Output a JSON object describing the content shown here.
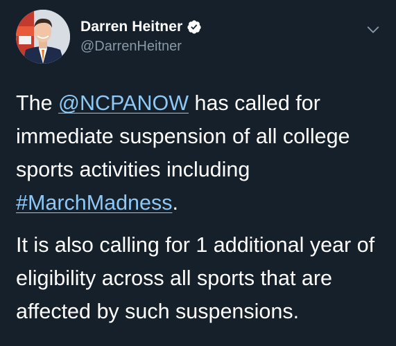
{
  "author": {
    "display_name": "Darren Heitner",
    "handle": "@DarrenHeitner",
    "verified": true
  },
  "tweet": {
    "p1_before_mention": "The ",
    "mention": "@NCPANOW",
    "p1_middle": " has called for immediate suspension of all college sports activities including ",
    "hashtag": "#MarchMadness",
    "p1_end": ".",
    "p2": "It is also calling for 1 additional year of eligibility across all sports that are affected by such suspensions."
  },
  "icons": {
    "verified": "verified-badge-icon",
    "menu": "chevron-down-icon"
  },
  "colors": {
    "background": "#15202b",
    "text": "#ffffff",
    "secondary_text": "#8899a6",
    "link": "#8ec8f4"
  }
}
